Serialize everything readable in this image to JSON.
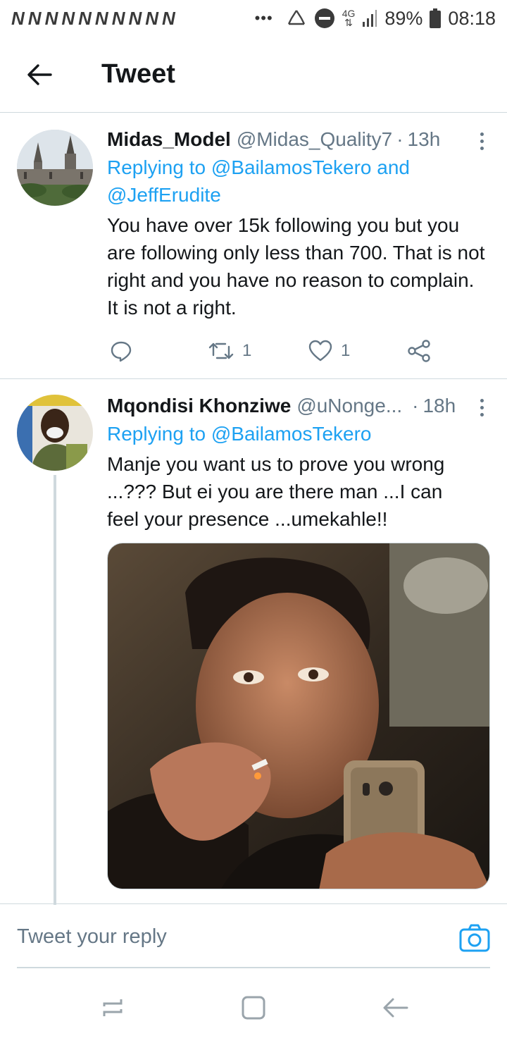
{
  "status_bar": {
    "notification_glyphs": [
      "N",
      "N",
      "N",
      "N",
      "N",
      "N",
      "N",
      "N",
      "N",
      "N"
    ],
    "more_indicator": "•••",
    "network": "4G",
    "battery": "89%",
    "time": "08:18",
    "icons": [
      "recycle-icon",
      "do-not-disturb-icon",
      "network-4g-icon",
      "signal-icon",
      "battery-icon"
    ]
  },
  "header": {
    "title": "Tweet",
    "back_icon": "arrow-left-icon"
  },
  "tweets": [
    {
      "name": "Midas_Model",
      "handle": "@Midas_Quality7",
      "separator": "·",
      "time": "13h",
      "replying_to_label": "Replying to",
      "replying_to_users": [
        "@BailamosTekero",
        "@JeffErudite"
      ],
      "conjunction": "and",
      "text": "You have over 15k following you but you are following only less than 700. That is not right and you have no reason to complain. It is not a right.",
      "avatar": "parliament-building-avatar",
      "actions": {
        "reply_count": "",
        "retweet_count": "1",
        "like_count": "1"
      }
    },
    {
      "name": "Mqondisi Khonziwe",
      "handle": "@uNonge...",
      "separator": "·",
      "time": "18h",
      "replying_to_label": "Replying to",
      "replying_to_users": [
        "@BailamosTekero"
      ],
      "text": "Manje you want us to prove you wrong ...??? But ei you are there man ...I can feel your presence ...umekahle!!",
      "avatar": "laughing-man-avatar",
      "media": "man-smoking-holding-phone-photo"
    }
  ],
  "reply_bar": {
    "placeholder": "Tweet your reply",
    "camera_icon": "camera-icon"
  },
  "nav_bar": {
    "icons": [
      "recent-apps-icon",
      "home-icon",
      "back-icon"
    ]
  },
  "colors": {
    "accent": "#1da1f2",
    "text_secondary": "#657786",
    "divider": "#cfd9de"
  }
}
